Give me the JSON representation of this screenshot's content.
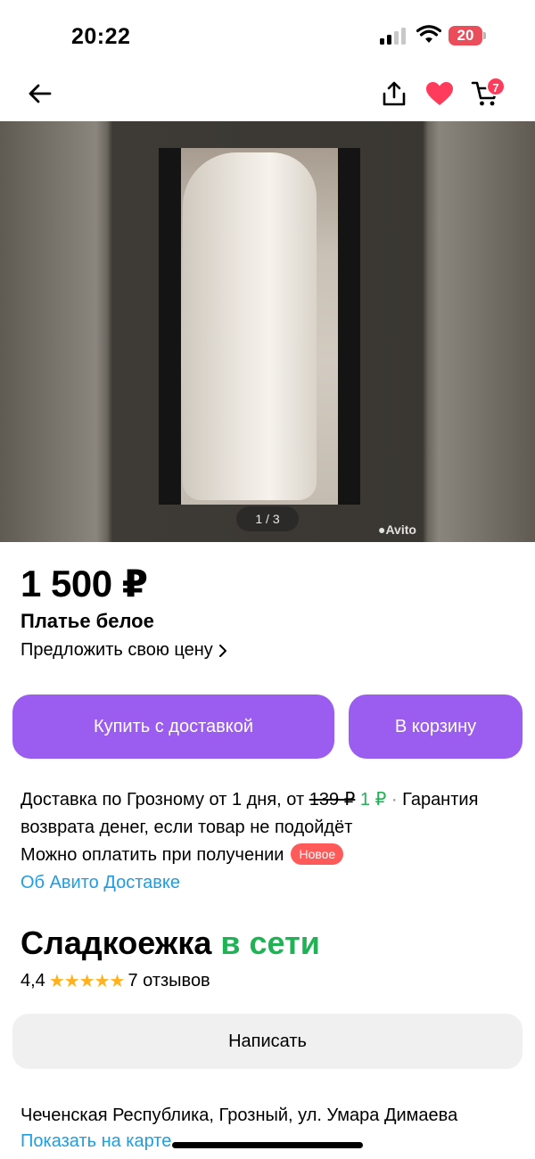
{
  "status_bar": {
    "time": "20:22",
    "battery": "20"
  },
  "header": {
    "cart_count": "7"
  },
  "gallery": {
    "counter": "1 / 3",
    "watermark": "Avito"
  },
  "product": {
    "price": "1 500 ₽",
    "title": "Платье белое",
    "offer_price_label": "Предложить свою цену"
  },
  "actions": {
    "buy_delivery_label": "Купить с доставкой",
    "add_to_cart_label": "В корзину"
  },
  "delivery": {
    "text_prefix": "Доставка по Грозному от 1 дня, от ",
    "old_price": "139 ₽",
    "new_price": "1 ₽",
    "separator": " · ",
    "guarantee": "Гарантия возврата денег, если товар не подойдёт",
    "payment": "Можно оплатить при получении",
    "new_badge": "Новое",
    "about_link": "Об Авито Доставке"
  },
  "seller": {
    "name": "Сладкоежка",
    "status": "в сети",
    "rating": "4,4",
    "stars": "★★★★★",
    "reviews": "7 отзывов",
    "write_label": "Написать"
  },
  "location": {
    "address": "Чеченская Республика, Грозный, ул. Умара Димаева",
    "map_link": "Показать на карте"
  },
  "colors": {
    "accent": "#9b5cf0",
    "online": "#1fb356",
    "link": "#1e9ee0",
    "badge": "#ff5a5a",
    "heart": "#ff3b5c"
  }
}
